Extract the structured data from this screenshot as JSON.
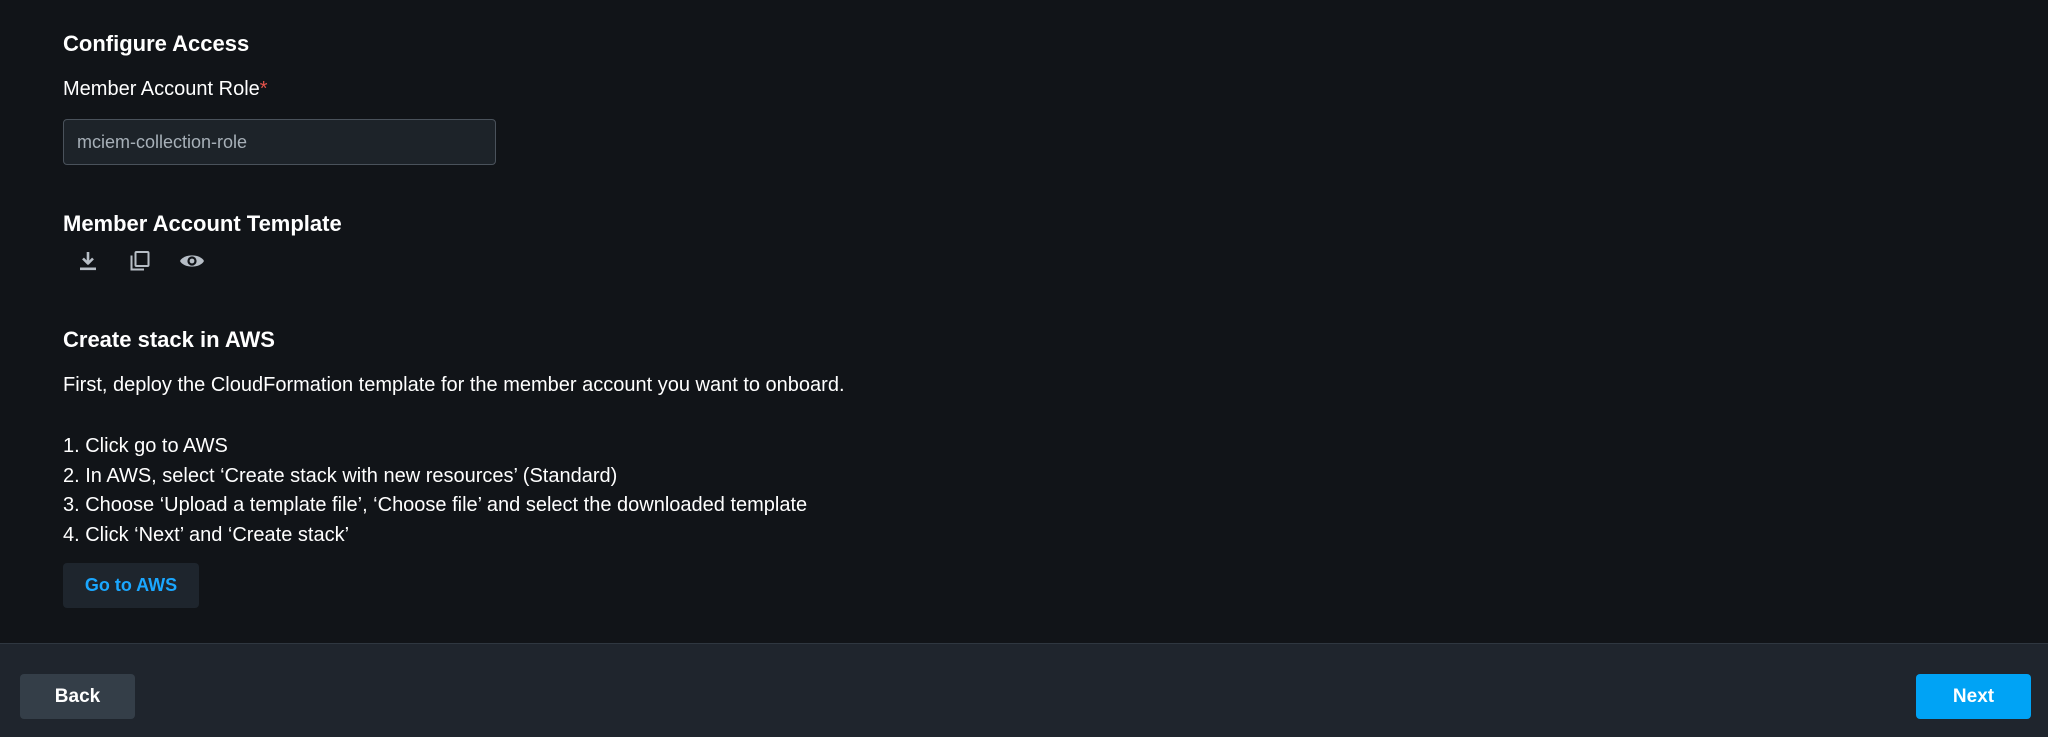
{
  "configure_access": {
    "title": "Configure Access",
    "role_label": "Member Account Role",
    "required_marker": "*",
    "role_value": "mciem-collection-role"
  },
  "template": {
    "title": "Member Account Template",
    "icons": [
      "download-icon",
      "copy-icon",
      "eye-icon"
    ]
  },
  "create_stack": {
    "title": "Create stack in AWS",
    "intro": "First, deploy the CloudFormation template for the member account you want to onboard.",
    "steps": [
      "1. Click go to AWS",
      "2. In AWS, select ‘Create stack with new resources’ (Standard)",
      "3. Choose ‘Upload a template file’, ‘Choose file’ and select the downloaded template",
      "4. Click ‘Next’ and ‘Create stack’"
    ],
    "go_button_label": "Go to AWS"
  },
  "footer": {
    "back_label": "Back",
    "next_label": "Next"
  },
  "colors": {
    "background": "#111418",
    "footer_background": "#1f252d",
    "accent": "#00a3f5",
    "link": "#1aa7ff",
    "required": "#e5534b"
  }
}
